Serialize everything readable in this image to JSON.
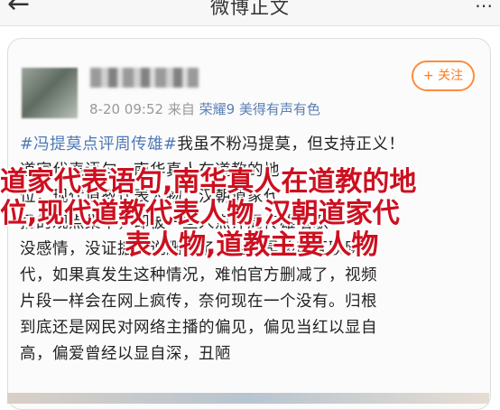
{
  "nav": {
    "back_glyph": "←",
    "title": "微博正文",
    "more_glyph": "⋯"
  },
  "post": {
    "timestamp": "8-20 09:52",
    "source_prefix": "来自",
    "device": "荣耀9 美得有声有色",
    "follow_label": "+ 关注",
    "lines": [
      {
        "topic": "#冯提莫点评周传雄#",
        "text": "我虽不粉冯提莫，但支持正义！"
      },
      {
        "topic": "",
        "text": "道家代表语句，南华真人在道教的地"
      },
      {
        "topic": "",
        "text": "位，现代道教代表人物，汉朝道家代"
      },
      {
        "topic": "",
        "text": "扬的观点集中，却被一些人点评周传雄唱歌"
      },
      {
        "topic": "",
        "text": "没感情，没证据就说删减了，现在是移动互联网时"
      },
      {
        "topic": "",
        "text": "代，如果真发生这种情况，难怕官方删减了，视频"
      },
      {
        "topic": "",
        "text": "片段一样会在网上疯传，奈何现在一个没有。归根"
      },
      {
        "topic": "",
        "text": "到底还是网民对网络主播的偏见，偏见当红以显自"
      },
      {
        "topic": "",
        "text": "高，偏爱曾经以显自深，丑陋"
      }
    ]
  },
  "overlay": {
    "line1": "道家代表语句,南华真人在道教的地",
    "line2": "位,现代道教代表人物,汉朝道家代",
    "line3": "表人物,道教主要人物"
  },
  "colors": {
    "topic": "#4d79b8",
    "follow": "#ff7a1a",
    "overlay": "#cc1020"
  }
}
